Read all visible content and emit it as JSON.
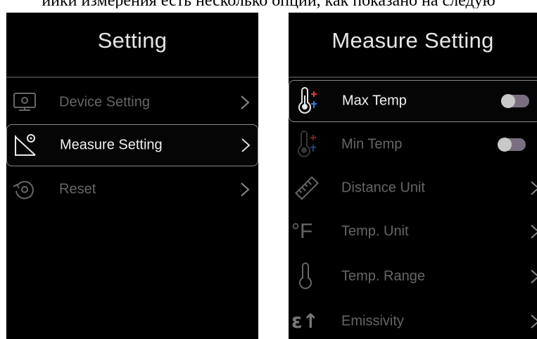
{
  "caption": "ийки измерения есть несколько опций, как показано на следую",
  "left_screen": {
    "title": "Setting",
    "items": [
      {
        "label": "Device Setting",
        "icon": "monitor-icon",
        "selected": false
      },
      {
        "label": "Measure Setting",
        "icon": "measure-angle-icon",
        "selected": true
      },
      {
        "label": "Reset",
        "icon": "reset-icon",
        "selected": false
      }
    ]
  },
  "right_screen": {
    "title": "Measure Setting",
    "items": [
      {
        "label": "Max Temp",
        "icon": "thermometer-max-icon",
        "control": "toggle",
        "toggle_on": false,
        "selected": true
      },
      {
        "label": "Min Temp",
        "icon": "thermometer-min-icon",
        "control": "toggle",
        "toggle_on": false,
        "selected": false
      },
      {
        "label": "Distance Unit",
        "icon": "ruler-icon",
        "control": "chevron",
        "selected": false
      },
      {
        "label": "Temp. Unit",
        "icon": "fahrenheit-icon",
        "icon_text": "°F",
        "control": "chevron",
        "selected": false
      },
      {
        "label": "Temp. Range",
        "icon": "thermometer-icon",
        "control": "chevron",
        "selected": false
      },
      {
        "label": "Emissivity",
        "icon": "emissivity-icon",
        "icon_text": "ε↑",
        "control": "chevron",
        "selected": false
      }
    ]
  },
  "colors": {
    "background": "#000000",
    "selected_text": "#f0f0f0",
    "dim_text": "#666666",
    "toggle_track": "#7a6f80",
    "toggle_knob": "#c8c8c8",
    "thermo_red": "#e23a3a",
    "thermo_blue": "#3a7ee2"
  }
}
